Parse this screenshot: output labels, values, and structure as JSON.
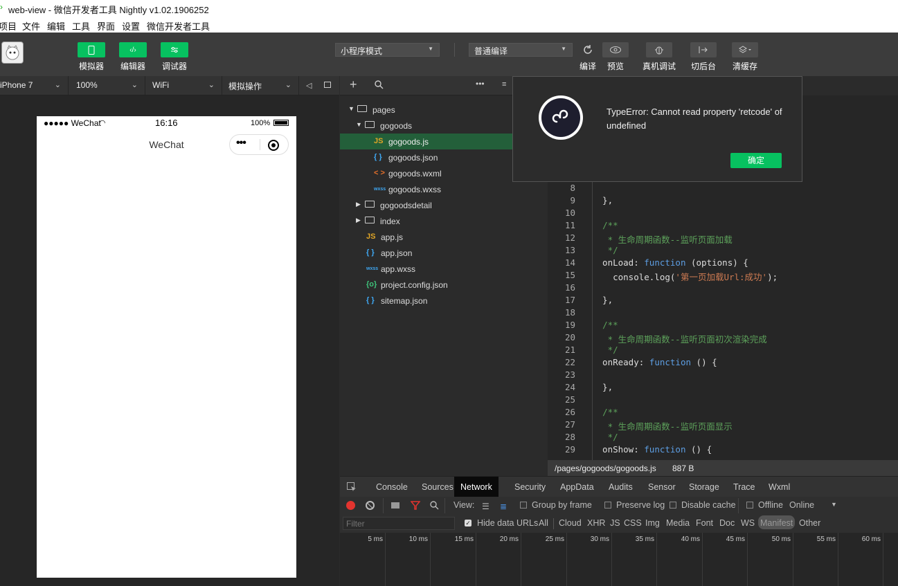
{
  "window": {
    "title": "web-view - 微信开发者工具 Nightly v1.02.1906252"
  },
  "menu": [
    "项目",
    "文件",
    "编辑",
    "工具",
    "界面",
    "设置",
    "微信开发者工具"
  ],
  "toolbar": {
    "left_buttons": [
      {
        "label": "模拟器",
        "icon": "phone-icon"
      },
      {
        "label": "编辑器",
        "icon": "code-icon"
      },
      {
        "label": "调试器",
        "icon": "sliders-icon"
      }
    ],
    "mode_select": "小程序模式",
    "compile_select": "普通编译",
    "right_buttons": [
      {
        "label": "编译",
        "icon": "refresh-icon"
      },
      {
        "label": "预览",
        "icon": "eye-icon"
      },
      {
        "label": "真机调试",
        "icon": "bug-icon"
      },
      {
        "label": "切后台",
        "icon": "switch-background-icon"
      },
      {
        "label": "清缓存",
        "icon": "layers-icon"
      }
    ]
  },
  "device_bar": {
    "device": "iPhone 7",
    "zoom": "100%",
    "network": "WiFi",
    "operation": "模拟操作"
  },
  "simulator": {
    "carrier": "●●●●● WeChat",
    "time": "16:16",
    "battery": "100%",
    "nav_title": "WeChat",
    "capsule_dots": "•••"
  },
  "file_tree": [
    {
      "name": "pages",
      "type": "folder-open",
      "indent": 0
    },
    {
      "name": "gogoods",
      "type": "folder-open",
      "indent": 1
    },
    {
      "name": "gogoods.js",
      "type": "js",
      "indent": 2,
      "selected": true
    },
    {
      "name": "gogoods.json",
      "type": "json",
      "indent": 2
    },
    {
      "name": "gogoods.wxml",
      "type": "wxml",
      "indent": 2
    },
    {
      "name": "gogoods.wxss",
      "type": "wxss",
      "indent": 2
    },
    {
      "name": "gogoodsdetail",
      "type": "folder",
      "indent": 1
    },
    {
      "name": "index",
      "type": "folder",
      "indent": 1
    },
    {
      "name": "app.js",
      "type": "js",
      "indent": 1
    },
    {
      "name": "app.json",
      "type": "json",
      "indent": 1
    },
    {
      "name": "app.wxss",
      "type": "wxss",
      "indent": 1
    },
    {
      "name": "project.config.json",
      "type": "config",
      "indent": 1
    },
    {
      "name": "sitemap.json",
      "type": "json",
      "indent": 1
    }
  ],
  "file_icons": {
    "js": "JS",
    "json": "{ }",
    "wxml": "< >",
    "wxss": "wxss",
    "config": "{o}"
  },
  "editor": {
    "lines": [
      {
        "n": "8",
        "html": ""
      },
      {
        "n": "9",
        "html": "  },"
      },
      {
        "n": "10",
        "html": ""
      },
      {
        "n": "11",
        "html": "  <span class=\"cm\">/**</span>"
      },
      {
        "n": "12",
        "html": "  <span class=\"cm\"> * 生命周期函数--监听页面加载</span>"
      },
      {
        "n": "13",
        "html": "  <span class=\"cm\"> */</span>"
      },
      {
        "n": "14",
        "html": "  onLoad: <span class=\"kw\">function</span> (options) {"
      },
      {
        "n": "15",
        "html": "    console.log(<span class=\"str\">'第一页加载Url:成功'</span>);"
      },
      {
        "n": "16",
        "html": ""
      },
      {
        "n": "17",
        "html": "  },"
      },
      {
        "n": "18",
        "html": ""
      },
      {
        "n": "19",
        "html": "  <span class=\"cm\">/**</span>"
      },
      {
        "n": "20",
        "html": "  <span class=\"cm\"> * 生命周期函数--监听页面初次渲染完成</span>"
      },
      {
        "n": "21",
        "html": "  <span class=\"cm\"> */</span>"
      },
      {
        "n": "22",
        "html": "  onReady: <span class=\"kw\">function</span> () {"
      },
      {
        "n": "23",
        "html": ""
      },
      {
        "n": "24",
        "html": "  },"
      },
      {
        "n": "25",
        "html": ""
      },
      {
        "n": "26",
        "html": "  <span class=\"cm\">/**</span>"
      },
      {
        "n": "27",
        "html": "  <span class=\"cm\"> * 生命周期函数--监听页面显示</span>"
      },
      {
        "n": "28",
        "html": "  <span class=\"cm\"> */</span>"
      },
      {
        "n": "29",
        "html": "  onShow: <span class=\"kw\">function</span> () {"
      }
    ],
    "status_path": "/pages/gogoods/gogoods.js",
    "status_size": "887 B"
  },
  "devtools": {
    "tabs": [
      "Console",
      "Sources",
      "Network",
      "Security",
      "AppData",
      "Audits",
      "Sensor",
      "Storage",
      "Trace",
      "Wxml"
    ],
    "active_tab": "Network",
    "view_label": "View:",
    "checkboxes": [
      "Group by frame",
      "Preserve log",
      "Disable cache",
      "Offline"
    ],
    "throttle": "Online",
    "filter_placeholder": "Filter",
    "hide_data_urls": "Hide data URLs",
    "filter_types": [
      "All",
      "Cloud",
      "XHR",
      "JS",
      "CSS",
      "Img",
      "Media",
      "Font",
      "Doc",
      "WS",
      "Manifest",
      "Other"
    ],
    "active_filter": "Manifest",
    "timeline": [
      "5 ms",
      "10 ms",
      "15 ms",
      "20 ms",
      "25 ms",
      "30 ms",
      "35 ms",
      "40 ms",
      "45 ms",
      "50 ms",
      "55 ms",
      "60 ms"
    ]
  },
  "dialog": {
    "message": "TypeError: Cannot read property 'retcode' of undefined",
    "ok": "确定"
  },
  "colors": {
    "accent": "#07c160",
    "selected_file": "#235f3a"
  }
}
